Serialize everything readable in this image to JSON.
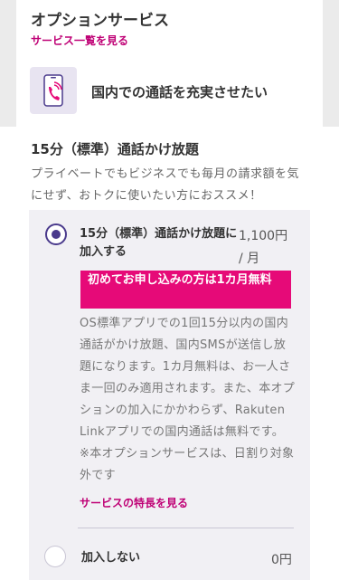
{
  "header": {
    "section_title": "オプションサービス",
    "see_all_label": "サービス一覧を見る"
  },
  "feature": {
    "icon": "smartphone-call-icon",
    "title": "国内での通話を充実させたい"
  },
  "plan": {
    "title": "15分（標準）通話かけ放題",
    "description": "プライベートでもビジネスでも毎月の請求額を気にせず、おトクに使いたい方におススメ！"
  },
  "options": [
    {
      "label": "15分（標準）通話かけ放題に加入する",
      "price": "1,100円",
      "unit": "/ 月",
      "selected": true,
      "promo": "初めてお申し込みの方は1カ月無料",
      "body": "OS標準アプリでの1回15分以内の国内通話がかけ放題、国内SMSが送信し放題になります。1カ月無料は、お一人さま一回のみ適用されます。また、本オプションの加入にかかわらず、Rakuten Linkアプリでの国内通話は無料です。",
      "note": "※本オプションサービスは、日割り対象外です",
      "link": "サービスの特長を見る"
    },
    {
      "label": "加入しない",
      "price": "0円",
      "selected": false
    }
  ],
  "colors": {
    "accent": "#bf0075",
    "promo_bg": "#e60a78",
    "radio": "#4a3a8c",
    "option_bg": "#f1f0f4",
    "icon_bg": "#e8e4f1"
  }
}
